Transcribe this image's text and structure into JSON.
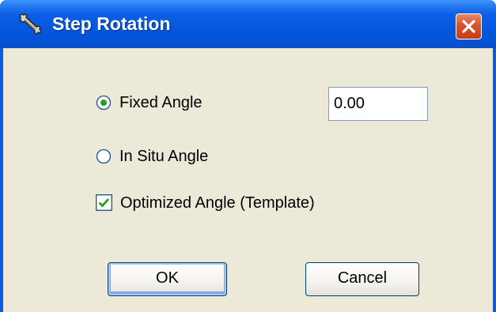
{
  "window": {
    "title": "Step Rotation",
    "title_icon": "bone-icon",
    "close_icon": "close-icon",
    "colors": {
      "titlebar": "#0a5ce0",
      "client": "#ece9d8",
      "close_button": "#d8532d",
      "check": "#21a121",
      "radio_dot": "#21a121"
    }
  },
  "options": {
    "fixed_angle": {
      "label": "Fixed Angle",
      "selected": true
    },
    "in_situ_angle": {
      "label": "In Situ Angle",
      "selected": false
    },
    "optimized_angle": {
      "label": "Optimized Angle (Template)",
      "checked": true
    }
  },
  "angle_field": {
    "value": "0.00"
  },
  "buttons": {
    "ok_label": "OK",
    "cancel_label": "Cancel"
  }
}
